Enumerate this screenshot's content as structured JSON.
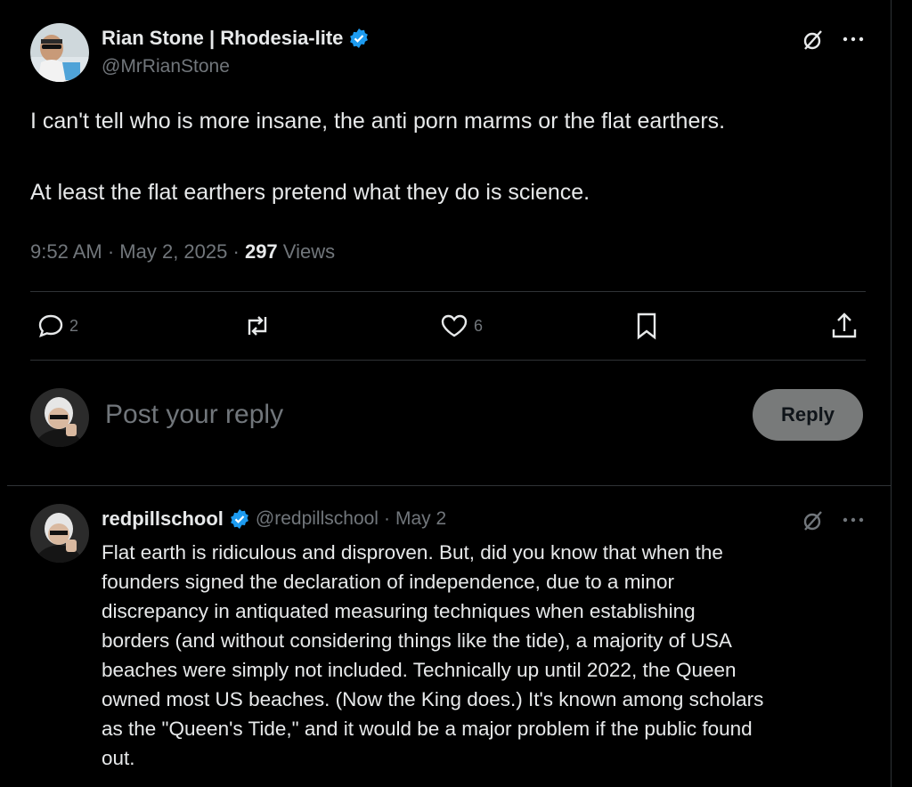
{
  "main_tweet": {
    "author_name": "Rian Stone | Rhodesia-lite",
    "handle": "@MrRianStone",
    "text_line1": "I can't tell who is more insane, the anti porn marms or the flat earthers.",
    "text_line2": "At least the flat earthers pretend what they do is science.",
    "time": "9:52 AM",
    "date": "May 2, 2025",
    "views_count": "297",
    "views_label": "Views",
    "replies_count": "2",
    "likes_count": "6"
  },
  "composer": {
    "placeholder": "Post your reply",
    "button_label": "Reply"
  },
  "reply_tweet": {
    "author_name": "redpillschool",
    "handle": "@redpillschool",
    "date": "May 2",
    "lines": [
      "Flat earth is ridiculous and disproven. But, did you know that when the",
      "founders signed the declaration of independence, due to a minor",
      "discrepancy in antiquated measuring techniques when establishing",
      "borders (and without considering things like the tide), a majority of USA",
      "beaches were simply not included. Technically up until 2022, the Queen",
      "owned most US beaches. (Now the King does.) It's known among scholars",
      "as the \"Queen's Tide,\" and it would be a major problem if the public found",
      "out."
    ]
  },
  "colors": {
    "background": "#000000",
    "text_primary": "#e7e9ea",
    "text_secondary": "#71767b",
    "verified_blue": "#1d9bf0",
    "divider": "#2f3336",
    "reply_button_bg": "#787a7a"
  },
  "icons": [
    "verified-badge-icon",
    "grok-icon",
    "more-icon",
    "reply-icon",
    "retweet-icon",
    "like-icon",
    "bookmark-icon",
    "share-icon"
  ]
}
